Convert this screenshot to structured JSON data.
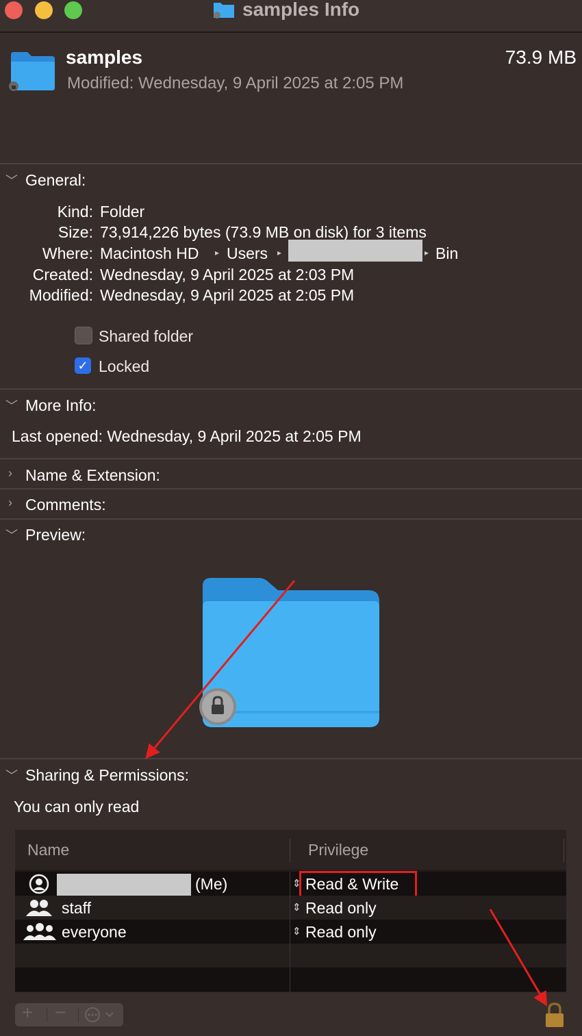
{
  "window": {
    "title": "samples Info"
  },
  "header": {
    "name": "samples",
    "size": "73.9 MB",
    "modified": "Modified: Wednesday, 9 April 2025 at 2:05 PM"
  },
  "general": {
    "title": "General:",
    "rows": [
      {
        "label": "Kind:",
        "value": "Folder"
      },
      {
        "label": "Size:",
        "value": "73,914,226 bytes (73.9 MB on disk) for 3 items"
      },
      {
        "label": "Where:",
        "value_a": "Macintosh HD",
        "value_b": "Users",
        "value_c": "Bin"
      },
      {
        "label": "Created:",
        "value": "Wednesday, 9 April 2025 at 2:03 PM"
      },
      {
        "label": "Modified:",
        "value": "Wednesday, 9 April 2025 at 2:05 PM"
      }
    ],
    "shared_folder": {
      "label": "Shared folder",
      "checked": false
    },
    "locked": {
      "label": "Locked",
      "checked": true
    }
  },
  "more_info": {
    "title": "More Info:",
    "last_opened": "Last opened: Wednesday, 9 April 2025 at 2:05 PM"
  },
  "name_extension": {
    "title": "Name & Extension:"
  },
  "comments": {
    "title": "Comments:"
  },
  "preview": {
    "title": "Preview:"
  },
  "sharing": {
    "title": "Sharing & Permissions:",
    "status": "You can only read",
    "headers": {
      "name": "Name",
      "privilege": "Privilege"
    },
    "rows": [
      {
        "name_suffix": "(Me)",
        "privilege": "Read & Write"
      },
      {
        "name": "staff",
        "privilege": "Read only"
      },
      {
        "name": "everyone",
        "privilege": "Read only"
      }
    ]
  },
  "colors": {
    "background": "#372d2b",
    "folder_blue": "#3fa9f0",
    "annotation_red": "#e0201f",
    "checkbox_blue": "#2d6ee8"
  },
  "icons": [
    "folder-icon",
    "lock-icon",
    "user-icon",
    "group-icon",
    "everyone-icon",
    "plus-icon",
    "minus-icon",
    "action-icon",
    "padlock-icon"
  ]
}
